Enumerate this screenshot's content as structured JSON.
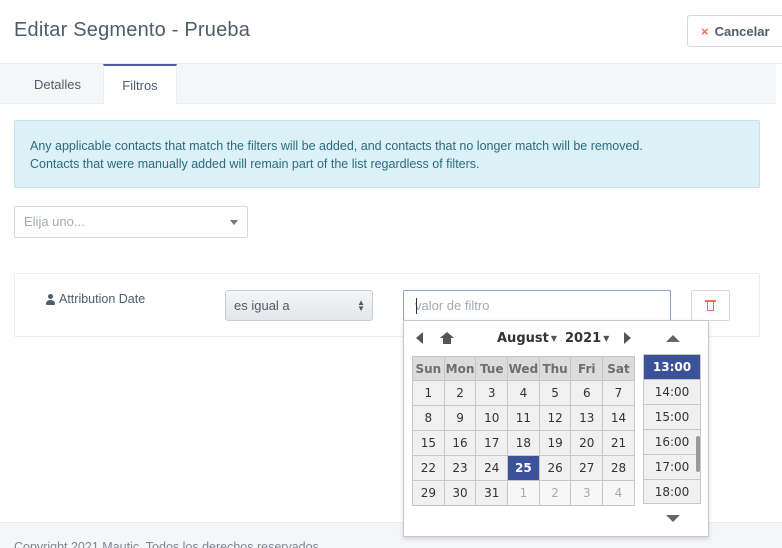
{
  "header": {
    "title": "Editar Segmento - Prueba",
    "cancel_label": "Cancelar",
    "cancel_icon": "×"
  },
  "tabs": [
    {
      "label": "Detalles",
      "active": false
    },
    {
      "label": "Filtros",
      "active": true
    }
  ],
  "alert": {
    "line1": "Any applicable contacts that match the filters will be added, and contacts that no longer match will be removed.",
    "line2": "Contacts that were manually added will remain part of the list regardless of filters."
  },
  "filter_add": {
    "placeholder": "Elija uno..."
  },
  "filter": {
    "field_label": "Attribution Date",
    "operator": "es igual a",
    "value_placeholder": "valor de filtro"
  },
  "datepicker": {
    "month": "August",
    "year": "2021",
    "weekdays": [
      "Sun",
      "Mon",
      "Tue",
      "Wed",
      "Thu",
      "Fri",
      "Sat"
    ],
    "weeks": [
      [
        "1",
        "2",
        "3",
        "4",
        "5",
        "6",
        "7"
      ],
      [
        "8",
        "9",
        "10",
        "11",
        "12",
        "13",
        "14"
      ],
      [
        "15",
        "16",
        "17",
        "18",
        "19",
        "20",
        "21"
      ],
      [
        "22",
        "23",
        "24",
        "25",
        "26",
        "27",
        "28"
      ],
      [
        "29",
        "30",
        "31",
        "1",
        "2",
        "3",
        "4"
      ]
    ],
    "selected_day": "25",
    "times": [
      "13:00",
      "14:00",
      "15:00",
      "16:00",
      "17:00",
      "18:00"
    ],
    "selected_time": "13:00",
    "accent_color": "#3b5199"
  },
  "footer": {
    "text": "Copyright 2021 Mautic. Todos los derechos reservados."
  },
  "colors": {
    "danger": "#f86b4f",
    "alert_bg": "#dcf0f7",
    "alert_text": "#2b6b82"
  }
}
